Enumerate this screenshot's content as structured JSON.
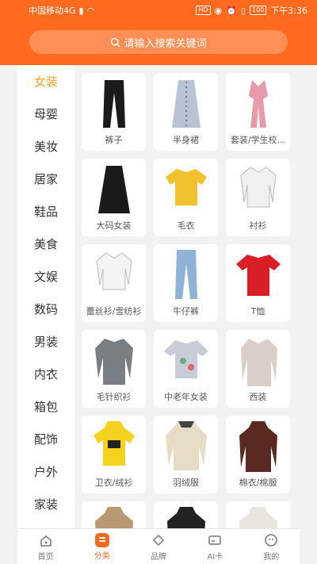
{
  "status_bar": {
    "carrier": "中国移动4G",
    "hd": "HD",
    "battery": "100",
    "time": "下午3:36"
  },
  "search": {
    "placeholder": "请输入搜索关键词"
  },
  "sidebar": {
    "items": [
      "女装",
      "母婴",
      "美妆",
      "居家",
      "鞋品",
      "美食",
      "文娱",
      "数码",
      "男装",
      "内衣",
      "箱包",
      "配饰",
      "户外",
      "家装"
    ],
    "active_index": 0
  },
  "grid": {
    "items": [
      {
        "label": "裤子",
        "icon": "pants-icon",
        "color": "#1a1a1a"
      },
      {
        "label": "半身裙",
        "icon": "skirt-icon",
        "color": "#b8c4d6"
      },
      {
        "label": "套装/学生校...",
        "icon": "jumpsuit-icon",
        "color": "#e89aaa"
      },
      {
        "label": "大码女装",
        "icon": "long-skirt-icon",
        "color": "#1a1a1a"
      },
      {
        "label": "毛衣",
        "icon": "sweater-icon",
        "color": "#f2c22e"
      },
      {
        "label": "衬衫",
        "icon": "shirt-icon",
        "color": "#f0f0ee"
      },
      {
        "label": "蕾丝衫/雪纺衫",
        "icon": "blouse-icon",
        "color": "#f4f4f2"
      },
      {
        "label": "牛仔裤",
        "icon": "jeans-icon",
        "color": "#8fb3d6"
      },
      {
        "label": "T恤",
        "icon": "tshirt-icon",
        "color": "#d81f26"
      },
      {
        "label": "毛针织衫",
        "icon": "cardigan-icon",
        "color": "#7a7d82"
      },
      {
        "label": "中老年女装",
        "icon": "floral-top-icon",
        "color": "#c8ccd6"
      },
      {
        "label": "西装",
        "icon": "blazer-icon",
        "color": "#d9cfc8"
      },
      {
        "label": "卫衣/绒衫",
        "icon": "hoodie-icon",
        "color": "#f5d21e"
      },
      {
        "label": "羽绒服",
        "icon": "parka-icon",
        "color": "#e6dcc4"
      },
      {
        "label": "棉衣/棉服",
        "icon": "coat-icon",
        "color": "#5a2a22"
      },
      {
        "label": "",
        "icon": "coat-icon",
        "color": "#b89a72"
      },
      {
        "label": "",
        "icon": "coat-icon",
        "color": "#222"
      },
      {
        "label": "",
        "icon": "coat-icon",
        "color": "#e8e4de"
      }
    ]
  },
  "bottom_nav": {
    "tabs": [
      {
        "label": "首页",
        "icon": "home-icon"
      },
      {
        "label": "分类",
        "icon": "category-icon"
      },
      {
        "label": "品牌",
        "icon": "brand-icon"
      },
      {
        "label": "AI卡",
        "icon": "card-icon"
      },
      {
        "label": "我的",
        "icon": "profile-icon"
      }
    ],
    "active_index": 1
  },
  "colors": {
    "accent": "#ff6a1f",
    "sidebar_active": "#f0a020"
  }
}
